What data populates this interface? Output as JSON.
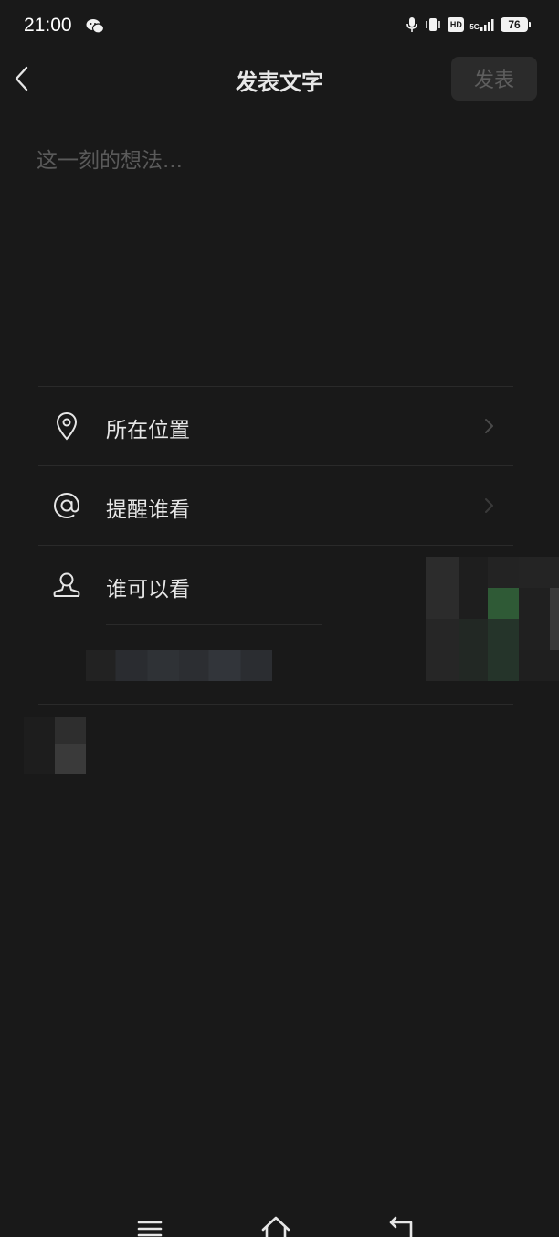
{
  "status_bar": {
    "time": "21:00",
    "network": "5G",
    "hd": "HD",
    "battery": "76",
    "icons": [
      "wechat-icon",
      "microphone-icon",
      "vibrate-icon",
      "hd-icon",
      "signal-5g-icon",
      "battery-icon"
    ]
  },
  "header": {
    "title": "发表文字",
    "publish_label": "发表",
    "back_icon": "chevron-left-icon"
  },
  "composer": {
    "placeholder": "这一刻的想法..."
  },
  "options": [
    {
      "label": "所在位置",
      "icon": "location-pin-icon"
    },
    {
      "label": "提醒谁看",
      "icon": "at-sign-icon"
    },
    {
      "label": "谁可以看",
      "icon": "person-icon"
    }
  ],
  "colors": {
    "background": "#191919",
    "text": "#e6e6e6",
    "placeholder": "#5a5a5a",
    "publish_bg": "#2b2b2b",
    "publish_text": "#5e5e5e",
    "divider": "#2a2a2a"
  },
  "nav_bar": {
    "icons": [
      "menu-icon",
      "home-icon",
      "back-icon"
    ]
  }
}
